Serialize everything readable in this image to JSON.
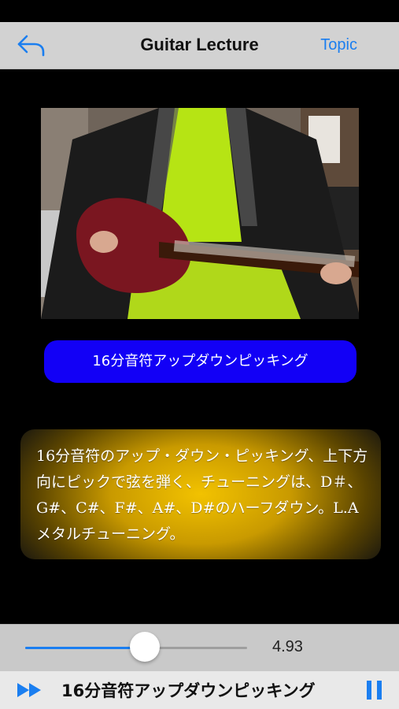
{
  "nav": {
    "title": "Guitar Lecture",
    "topic_label": "Topic",
    "back_icon": "back-arrow-icon"
  },
  "video": {
    "description": "guitar lesson video frame"
  },
  "lesson": {
    "button_label": "16分音符アップダウンピッキング",
    "description": "16分音符のアップ・ダウン・ピッキング、上下方向にピックで弦を弾く、チューニングは、D＃、G#、C#、F#、A#、D#のハーフダウン。L.Aメタルチューニング。"
  },
  "player": {
    "slider_value": "4.93",
    "slider_fraction": 0.54,
    "now_playing_title": "16分音符アップダウンピッキング",
    "forward_icon": "fast-forward-icon",
    "pause_icon": "pause-icon"
  },
  "colors": {
    "accent_blue": "#1a7ef0",
    "lesson_button": "#1200f6",
    "panel_gold": "#f2c200"
  }
}
